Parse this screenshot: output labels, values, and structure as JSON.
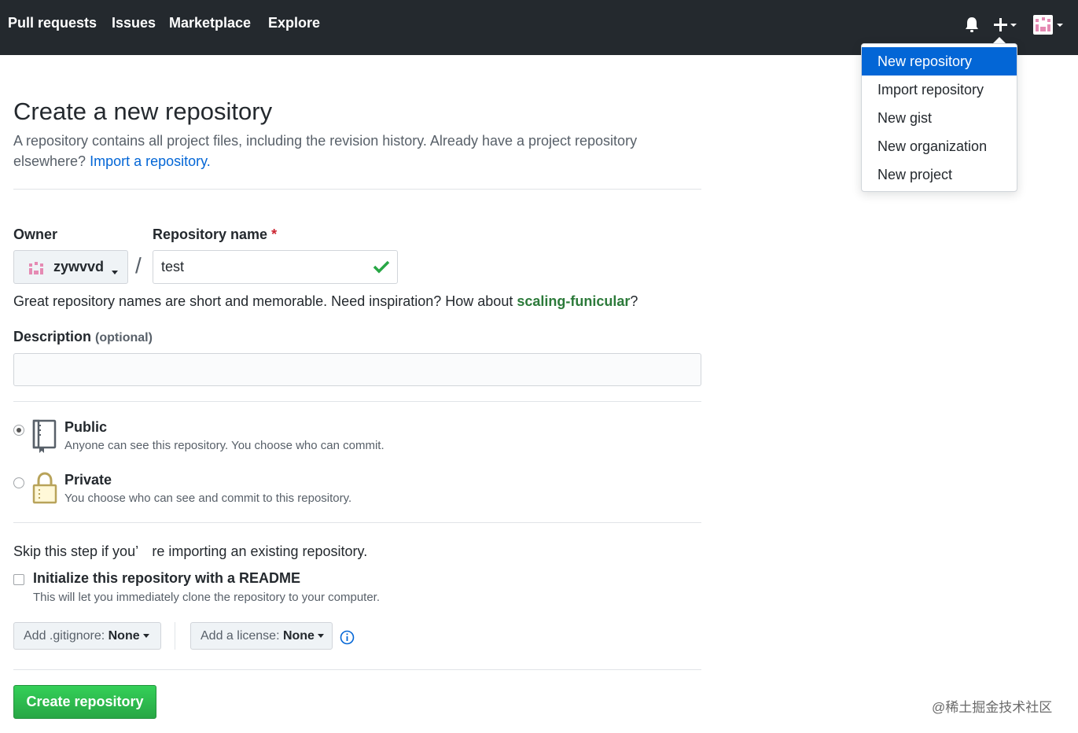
{
  "nav": {
    "items": [
      "Pull requests",
      "Issues",
      "Marketplace",
      "Explore"
    ]
  },
  "header_icons": [
    "bell-icon",
    "plus-icon",
    "avatar"
  ],
  "dropdown": {
    "items": [
      "New repository",
      "Import repository",
      "New gist",
      "New organization",
      "New project"
    ],
    "active": "New repository"
  },
  "page": {
    "title": "Create a new repository",
    "subtitle": "A repository contains all project files, including the revision history. Already have a project repository elsewhere?",
    "import_link": "Import a repository."
  },
  "form": {
    "owner_label": "Owner",
    "owner_value": "zywvvd",
    "separator": "/",
    "repo_label": "Repository name",
    "required_mark": "*",
    "repo_value": "test",
    "hint_prefix": "Great repository names are short and memorable. Need inspiration? How about ",
    "hint_suggestion": "scaling-funicular",
    "hint_suffix": "?",
    "description_label": "Description",
    "description_optional": "(optional)",
    "description_value": ""
  },
  "visibility": {
    "public_title": "Public",
    "public_note": "Anyone can see this repository. You choose who can commit.",
    "private_title": "Private",
    "private_note": "You choose who can see and commit to this repository.",
    "selected": "Public"
  },
  "init": {
    "skip_text": "Skip this step if you’　re importing an existing repository.",
    "readme_title": "Initialize this repository with a README",
    "readme_note": "This will let you immediately clone the repository to your computer.",
    "readme_checked": false,
    "gitignore_prefix": "Add .gitignore: ",
    "gitignore_value": "None",
    "license_prefix": "Add a license: ",
    "license_value": "None"
  },
  "submit_label": "Create repository",
  "watermark": "@稀土掘金技术社区",
  "colors": {
    "header_bg": "#24292e",
    "accent_blue": "#0366d6",
    "success_green": "#28a745",
    "required_red": "#cb2431"
  }
}
